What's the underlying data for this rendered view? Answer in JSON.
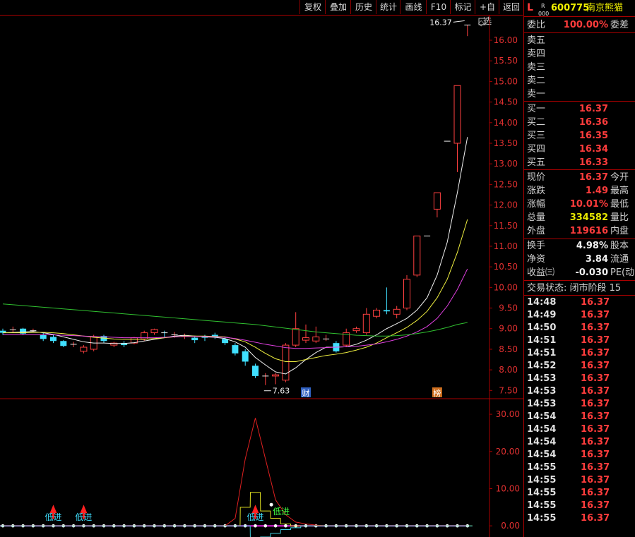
{
  "toolbar": {
    "buttons": [
      "复权",
      "叠加",
      "历史",
      "统计",
      "画线",
      "F10",
      "标记",
      "+自选",
      "返回"
    ]
  },
  "stock": {
    "market_flag": "L",
    "sub_flag_top": "R",
    "sub_flag_bottom": "000",
    "code": "600775",
    "name": "南京熊猫"
  },
  "order_ratio": {
    "label": "委比",
    "value": "100.00%",
    "diff_label": "委差"
  },
  "sell_levels": [
    {
      "label": "卖五",
      "price": ""
    },
    {
      "label": "卖四",
      "price": ""
    },
    {
      "label": "卖三",
      "price": ""
    },
    {
      "label": "卖二",
      "price": ""
    },
    {
      "label": "卖一",
      "price": ""
    }
  ],
  "buy_levels": [
    {
      "label": "买一",
      "price": "16.37"
    },
    {
      "label": "买二",
      "price": "16.36"
    },
    {
      "label": "买三",
      "price": "16.35"
    },
    {
      "label": "买四",
      "price": "16.34"
    },
    {
      "label": "买五",
      "price": "16.33"
    }
  ],
  "quote": [
    {
      "label": "现价",
      "value": "16.37",
      "tag": "今开",
      "color": "#ff3c3c"
    },
    {
      "label": "涨跌",
      "value": "1.49",
      "tag": "最高",
      "color": "#ff3c3c"
    },
    {
      "label": "涨幅",
      "value": "10.01%",
      "tag": "最低",
      "color": "#ff3c3c"
    },
    {
      "label": "总量",
      "value": "334582",
      "tag": "量比",
      "color": "#e8e800"
    },
    {
      "label": "外盘",
      "value": "119616",
      "tag": "内盘",
      "color": "#ff3c3c"
    }
  ],
  "stats": [
    {
      "label": "换手",
      "value": "4.98%",
      "tag": "股本"
    },
    {
      "label": "净资",
      "value": "3.84",
      "tag": "流通"
    },
    {
      "label": "收益㈢",
      "value": "-0.030",
      "tag": "PE(动"
    }
  ],
  "trade_status": "交易状态: 闭市阶段 15",
  "ticks": [
    {
      "time": "14:48",
      "price": "16.37"
    },
    {
      "time": "14:49",
      "price": "16.37"
    },
    {
      "time": "14:50",
      "price": "16.37"
    },
    {
      "time": "14:51",
      "price": "16.37"
    },
    {
      "time": "14:51",
      "price": "16.37"
    },
    {
      "time": "14:52",
      "price": "16.37"
    },
    {
      "time": "14:53",
      "price": "16.37"
    },
    {
      "time": "14:53",
      "price": "16.37"
    },
    {
      "time": "14:53",
      "price": "16.37"
    },
    {
      "time": "14:54",
      "price": "16.37"
    },
    {
      "time": "14:54",
      "price": "16.37"
    },
    {
      "time": "14:54",
      "price": "16.37"
    },
    {
      "time": "14:54",
      "price": "16.37"
    },
    {
      "time": "14:55",
      "price": "16.37"
    },
    {
      "time": "14:55",
      "price": "16.37"
    },
    {
      "time": "14:55",
      "price": "16.37"
    },
    {
      "time": "14:55",
      "price": "16.37"
    },
    {
      "time": "14:55",
      "price": "16.37"
    }
  ],
  "chart_data": [
    {
      "type": "candlestick",
      "ylim": [
        7.3,
        16.6
      ],
      "y_ticks": [
        "16.00",
        "15.50",
        "15.00",
        "14.50",
        "14.00",
        "13.50",
        "13.00",
        "12.50",
        "12.00",
        "11.50",
        "11.00",
        "10.50",
        "10.00",
        "9.50",
        "9.00",
        "8.50",
        "8.00",
        "7.50"
      ],
      "annotations": {
        "high_label": "16.37",
        "low_label": "7.63",
        "event_label_1": "财",
        "event_label_2": "榜"
      },
      "candles": [
        {
          "o": 8.95,
          "h": 9.0,
          "l": 8.85,
          "c": 8.9
        },
        {
          "o": 8.97,
          "h": 9.05,
          "l": 8.9,
          "c": 8.97
        },
        {
          "o": 9.0,
          "h": 9.02,
          "l": 8.85,
          "c": 8.88
        },
        {
          "o": 8.95,
          "h": 9.0,
          "l": 8.9,
          "c": 8.95
        },
        {
          "o": 8.85,
          "h": 8.9,
          "l": 8.7,
          "c": 8.75
        },
        {
          "o": 8.8,
          "h": 8.85,
          "l": 8.65,
          "c": 8.7
        },
        {
          "o": 8.7,
          "h": 8.72,
          "l": 8.55,
          "c": 8.58
        },
        {
          "o": 8.6,
          "h": 8.68,
          "l": 8.55,
          "c": 8.62
        },
        {
          "o": 8.45,
          "h": 8.6,
          "l": 8.4,
          "c": 8.55
        },
        {
          "o": 8.5,
          "h": 8.85,
          "l": 8.45,
          "c": 8.8
        },
        {
          "o": 8.82,
          "h": 8.85,
          "l": 8.65,
          "c": 8.7
        },
        {
          "o": 8.6,
          "h": 8.68,
          "l": 8.55,
          "c": 8.65
        },
        {
          "o": 8.65,
          "h": 8.7,
          "l": 8.55,
          "c": 8.6
        },
        {
          "o": 8.65,
          "h": 8.8,
          "l": 8.62,
          "c": 8.78
        },
        {
          "o": 8.75,
          "h": 8.95,
          "l": 8.7,
          "c": 8.9
        },
        {
          "o": 8.9,
          "h": 9.0,
          "l": 8.85,
          "c": 8.98
        },
        {
          "o": 8.9,
          "h": 8.95,
          "l": 8.8,
          "c": 8.88
        },
        {
          "o": 8.85,
          "h": 8.92,
          "l": 8.78,
          "c": 8.85
        },
        {
          "o": 8.82,
          "h": 8.88,
          "l": 8.75,
          "c": 8.82
        },
        {
          "o": 8.78,
          "h": 8.8,
          "l": 8.65,
          "c": 8.72
        },
        {
          "o": 8.8,
          "h": 8.85,
          "l": 8.7,
          "c": 8.78
        },
        {
          "o": 8.85,
          "h": 8.9,
          "l": 8.75,
          "c": 8.8
        },
        {
          "o": 8.75,
          "h": 8.8,
          "l": 8.6,
          "c": 8.65
        },
        {
          "o": 8.6,
          "h": 8.65,
          "l": 8.35,
          "c": 8.4
        },
        {
          "o": 8.45,
          "h": 8.5,
          "l": 8.1,
          "c": 8.2
        },
        {
          "o": 8.1,
          "h": 8.15,
          "l": 7.8,
          "c": 7.85
        },
        {
          "o": 7.85,
          "h": 7.92,
          "l": 7.63,
          "c": 7.85
        },
        {
          "o": 7.85,
          "h": 7.92,
          "l": 7.65,
          "c": 7.88
        },
        {
          "o": 7.75,
          "h": 8.65,
          "l": 7.7,
          "c": 8.6
        },
        {
          "o": 8.6,
          "h": 9.4,
          "l": 8.55,
          "c": 9.0
        },
        {
          "o": 8.72,
          "h": 9.1,
          "l": 8.65,
          "c": 8.78
        },
        {
          "o": 8.7,
          "h": 9.05,
          "l": 8.65,
          "c": 8.8
        },
        {
          "o": 8.75,
          "h": 8.85,
          "l": 8.7,
          "c": 8.75
        },
        {
          "o": 8.65,
          "h": 8.7,
          "l": 8.42,
          "c": 8.45
        },
        {
          "o": 8.6,
          "h": 9.0,
          "l": 8.55,
          "c": 8.9
        },
        {
          "o": 8.95,
          "h": 9.05,
          "l": 8.9,
          "c": 9.0
        },
        {
          "o": 8.9,
          "h": 9.5,
          "l": 8.85,
          "c": 9.35
        },
        {
          "o": 9.3,
          "h": 9.5,
          "l": 9.25,
          "c": 9.45
        },
        {
          "o": 9.45,
          "h": 10.0,
          "l": 9.35,
          "c": 9.42
        },
        {
          "o": 9.35,
          "h": 9.55,
          "l": 9.25,
          "c": 9.47
        },
        {
          "o": 9.5,
          "h": 10.3,
          "l": 9.45,
          "c": 10.2
        },
        {
          "o": 10.3,
          "h": 11.25,
          "l": 10.25,
          "c": 11.25
        },
        {
          "o": 11.25,
          "h": 11.25,
          "l": 11.25,
          "c": 11.25
        },
        {
          "o": 11.9,
          "h": 12.3,
          "l": 11.7,
          "c": 12.3
        },
        {
          "o": 13.55,
          "h": 13.55,
          "l": 13.55,
          "c": 13.55
        },
        {
          "o": 13.5,
          "h": 14.9,
          "l": 12.8,
          "c": 14.9
        },
        {
          "o": 16.37,
          "h": 16.37,
          "l": 16.1,
          "c": 16.37
        }
      ],
      "ma_series": [
        {
          "color": "#f0f0f0",
          "values": [
            8.9,
            8.91,
            8.92,
            8.93,
            8.9,
            8.86,
            8.8,
            8.74,
            8.68,
            8.65,
            8.65,
            8.64,
            8.64,
            8.66,
            8.7,
            8.74,
            8.78,
            8.82,
            8.84,
            8.82,
            8.8,
            8.79,
            8.76,
            8.68,
            8.55,
            8.3,
            8.12,
            7.95,
            7.9,
            8.05,
            8.25,
            8.42,
            8.55,
            8.55,
            8.56,
            8.62,
            8.72,
            8.85,
            9.0,
            9.12,
            9.25,
            9.45,
            9.75,
            10.3,
            11.1,
            12.3,
            13.65
          ]
        },
        {
          "color": "#f0f040",
          "values": [
            8.9,
            8.9,
            8.9,
            8.91,
            8.91,
            8.9,
            8.88,
            8.85,
            8.82,
            8.79,
            8.77,
            8.75,
            8.74,
            8.74,
            8.74,
            8.76,
            8.78,
            8.8,
            8.82,
            8.82,
            8.82,
            8.81,
            8.8,
            8.75,
            8.68,
            8.55,
            8.4,
            8.27,
            8.2,
            8.2,
            8.25,
            8.3,
            8.35,
            8.38,
            8.42,
            8.48,
            8.55,
            8.65,
            8.78,
            8.9,
            9.03,
            9.2,
            9.42,
            9.75,
            10.2,
            10.85,
            11.65
          ]
        },
        {
          "color": "#e040e0",
          "values": [
            8.85,
            8.85,
            8.85,
            8.85,
            8.85,
            8.85,
            8.84,
            8.83,
            8.82,
            8.81,
            8.8,
            8.79,
            8.78,
            8.78,
            8.78,
            8.78,
            8.79,
            8.8,
            8.81,
            8.81,
            8.81,
            8.8,
            8.79,
            8.76,
            8.72,
            8.67,
            8.62,
            8.58,
            8.54,
            8.52,
            8.52,
            8.53,
            8.54,
            8.55,
            8.56,
            8.57,
            8.6,
            8.63,
            8.68,
            8.74,
            8.82,
            8.92,
            9.05,
            9.25,
            9.55,
            9.95,
            10.45
          ]
        },
        {
          "color": "#30c030",
          "values": [
            9.6,
            9.58,
            9.56,
            9.54,
            9.52,
            9.5,
            9.48,
            9.46,
            9.44,
            9.42,
            9.4,
            9.38,
            9.36,
            9.34,
            9.32,
            9.3,
            9.28,
            9.26,
            9.24,
            9.22,
            9.2,
            9.18,
            9.16,
            9.14,
            9.12,
            9.1,
            9.07,
            9.04,
            9.01,
            8.98,
            8.95,
            8.92,
            8.9,
            8.88,
            8.86,
            8.84,
            8.83,
            8.82,
            8.82,
            8.83,
            8.85,
            8.88,
            8.92,
            8.97,
            9.03,
            9.1,
            9.15
          ]
        }
      ]
    },
    {
      "type": "line",
      "ylim": [
        -3,
        34
      ],
      "y_ticks": [
        "30.00",
        "20.00",
        "10.00",
        "0.00"
      ],
      "series": [
        {
          "color": "#e02020",
          "values": [
            0,
            0,
            0,
            0,
            0,
            0,
            0,
            0,
            0,
            0,
            0,
            0,
            0,
            0,
            0,
            0,
            0,
            0,
            0,
            0,
            0,
            0,
            0,
            2,
            18,
            29,
            18,
            7,
            3,
            1,
            0.5,
            0.2,
            0,
            0,
            0,
            0,
            0,
            0,
            0,
            0,
            0,
            0,
            0,
            0,
            0,
            0,
            0
          ]
        },
        {
          "color": "#e0e020",
          "values": [
            0,
            0,
            0,
            0,
            0,
            0,
            0,
            0,
            0,
            0,
            0,
            0,
            0,
            0,
            0,
            0,
            0,
            0,
            0,
            0,
            0,
            0,
            0,
            0,
            5,
            9,
            4,
            2,
            0.5,
            0,
            0,
            0,
            0,
            0,
            0,
            0,
            0,
            0,
            0,
            0,
            0,
            0,
            0,
            0,
            0,
            0,
            0
          ]
        },
        {
          "color": "#40d0e0",
          "values": [
            0,
            0,
            0,
            0,
            0,
            0,
            0,
            0,
            0,
            0,
            0,
            0,
            0,
            0,
            0,
            0,
            0,
            0,
            0,
            0,
            0,
            0,
            0,
            0,
            0,
            -5,
            -3,
            -2,
            -1,
            -0.5,
            0,
            0,
            0,
            0,
            0,
            0,
            0,
            0,
            0,
            0,
            0,
            0,
            0,
            0,
            0,
            0,
            0
          ]
        }
      ],
      "signals": [
        {
          "index": 5,
          "label": "低进"
        },
        {
          "index": 8,
          "label": "低进"
        },
        {
          "index": 25,
          "label": "低进"
        },
        {
          "index": 27,
          "label": "低进"
        }
      ]
    }
  ]
}
